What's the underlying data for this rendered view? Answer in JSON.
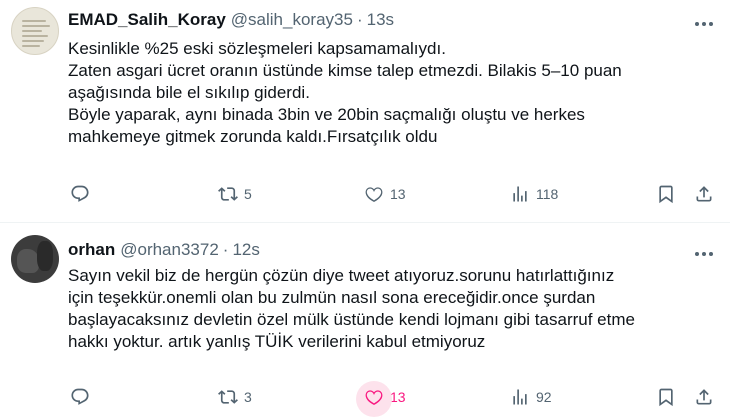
{
  "tweets": [
    {
      "name": "EMAD_Salih_Koray",
      "handle": "@salih_koray35",
      "separator": "·",
      "time": "13s",
      "lines": [
        "Kesinlikle %25 eski sözleşmeleri kapsamamalıydı.",
        "Zaten asgari ücret oranın üstünde kimse talep etmezdi. Bilakis 5–10 puan",
        "aşağısında bile el sıkılıp giderdi.",
        "Böyle yaparak, aynı binada 3bin ve 20bin saçmalığı oluştu ve herkes",
        "mahkemeye gitmek zorunda kaldı.Fırsatçılık oldu"
      ],
      "reply_icon": "reply-icon",
      "retweets": "5",
      "likes": "13",
      "views": "118",
      "liked": false
    },
    {
      "name": "orhan",
      "handle": "@orhan3372",
      "separator": "·",
      "time": "12s",
      "lines": [
        "Sayın vekil biz de hergün çözün diye tweet atıyoruz.sorunu hatırlattığınız",
        "için teşekkür.onemli olan bu zulmün nasıl sona ereceğidir.once şurdan",
        "başlayacaksınız devletin özel mülk üstünde kendi lojmanı gibi tasarruf etme",
        "hakkı yoktur. artık yanlış TÜİK verilerini kabul etmiyoruz"
      ],
      "retweets": "3",
      "likes": "13",
      "views": "92",
      "liked": true
    }
  ],
  "colors": {
    "text": "#0f1419",
    "secondary": "#536471",
    "like_active": "#f91880",
    "divider": "#eff3f4"
  }
}
